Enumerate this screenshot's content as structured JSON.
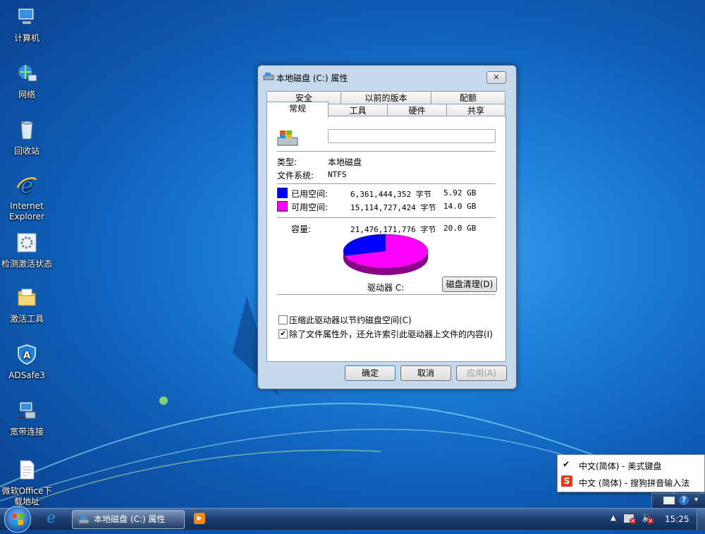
{
  "desktop": {
    "icons": [
      {
        "label": "计算机"
      },
      {
        "label": "网络"
      },
      {
        "label": "回收站"
      },
      {
        "label": "Internet Explorer"
      },
      {
        "label": "检测激活状态"
      },
      {
        "label": "激活工具"
      },
      {
        "label": "ADSafe3"
      },
      {
        "label": "宽带连接"
      },
      {
        "label": "微软Office下载地址"
      }
    ]
  },
  "window": {
    "title": "本地磁盘 (C:) 属性",
    "close_label": "✕",
    "tabs_back": [
      "安全",
      "以前的版本",
      "配额"
    ],
    "tabs_front": [
      "常规",
      "工具",
      "硬件",
      "共享"
    ],
    "name_input_value": "",
    "type_label": "类型:",
    "type_value": "本地磁盘",
    "fs_label": "文件系统:",
    "fs_value": "NTFS",
    "used_label": "已用空间:",
    "used_bytes": "6,361,444,352 字节",
    "used_size": "5.92 GB",
    "free_label": "可用空间:",
    "free_bytes": "15,114,727,424 字节",
    "free_size": "14.0 GB",
    "capacity_label": "容量:",
    "capacity_bytes": "21,476,171,776 字节",
    "capacity_size": "20.0 GB",
    "drive_label": "驱动器 C:",
    "cleanup_button": "磁盘清理(D)",
    "compress_label": "压缩此驱动器以节约磁盘空间(C)",
    "compress_checked": false,
    "index_label": "除了文件属性外，还允许索引此驱动器上文件的内容(I)",
    "index_checked": true,
    "ok_button": "确定",
    "cancel_button": "取消",
    "apply_button": "应用(A)",
    "colors": {
      "used": "#0000ff",
      "free": "#ff00ff"
    }
  },
  "disk_usage": {
    "used_fraction": 0.296
  },
  "ime_popup": {
    "items": [
      {
        "label": "中文(简体) - 美式键盘",
        "checked": true
      },
      {
        "label": "中文 (简体) - 搜狗拼音输入法",
        "checked": false
      }
    ]
  },
  "taskbar": {
    "task_label": "本地磁盘 (C:) 属性",
    "clock": "15:25"
  }
}
